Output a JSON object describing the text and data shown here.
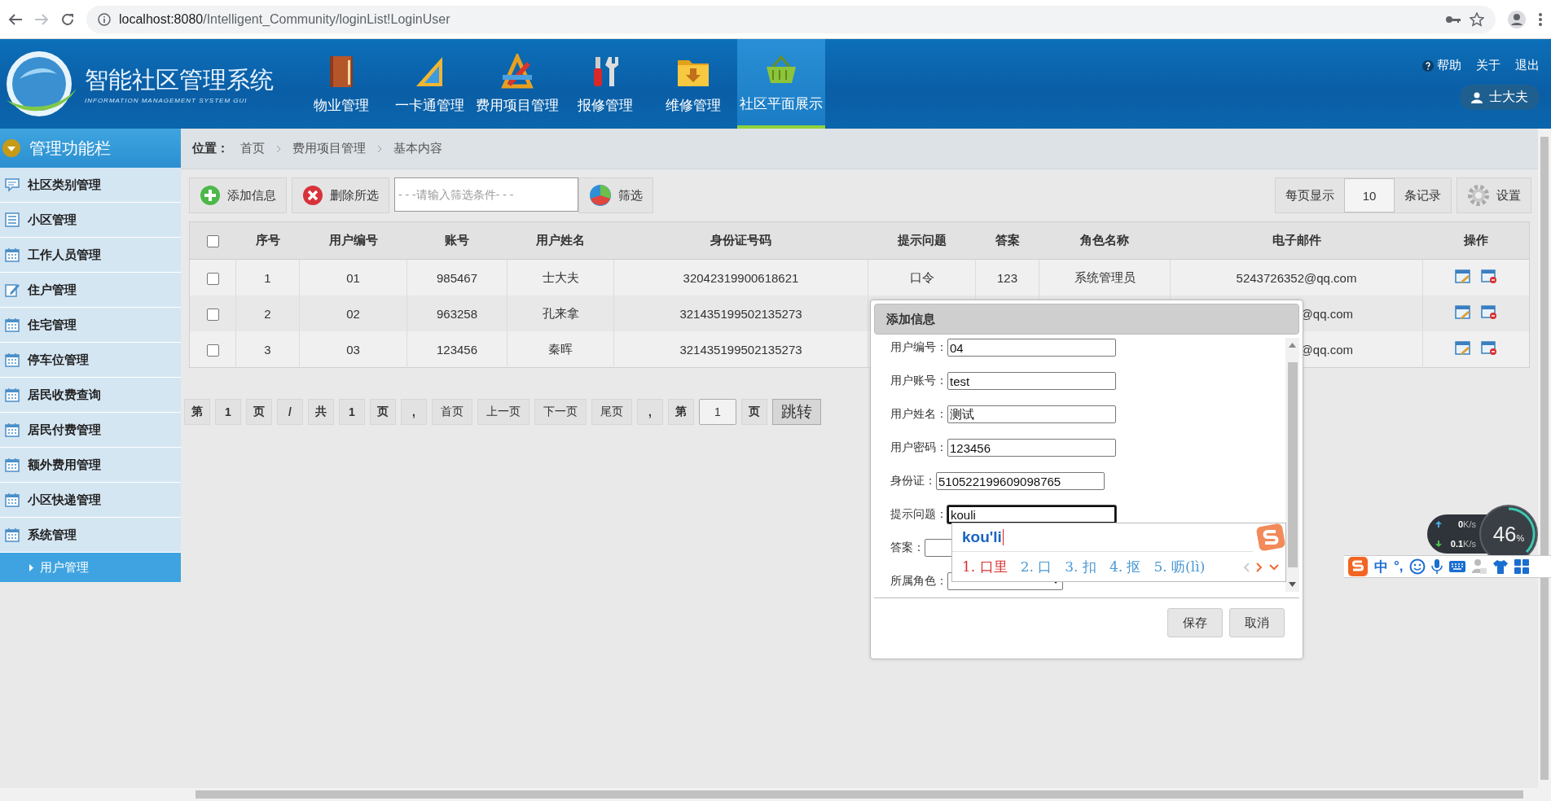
{
  "browser": {
    "url_host": "localhost:8080",
    "url_path": "/Intelligent_Community/loginList!LoginUser"
  },
  "header": {
    "title": "智能社区管理系统",
    "subtitle": "INFORMATION MANAGEMENT SYSTEM GUI",
    "nav": [
      {
        "label": "物业管理",
        "selected": false
      },
      {
        "label": "一卡通管理",
        "selected": false
      },
      {
        "label": "费用项目管理",
        "selected": false
      },
      {
        "label": "报修管理",
        "selected": false
      },
      {
        "label": "维修管理",
        "selected": false
      },
      {
        "label": "社区平面展示",
        "selected": true
      }
    ],
    "links": [
      "帮助",
      "关于",
      "退出"
    ],
    "user": "士大夫"
  },
  "sidebar": {
    "title": "管理功能栏",
    "items": [
      {
        "label": "社区类别管理",
        "selected": false
      },
      {
        "label": "小区管理",
        "selected": false
      },
      {
        "label": "工作人员管理",
        "selected": false
      },
      {
        "label": "住户管理",
        "selected": false
      },
      {
        "label": "住宅管理",
        "selected": false
      },
      {
        "label": "停车位管理",
        "selected": false
      },
      {
        "label": "居民收费查询",
        "selected": false
      },
      {
        "label": "居民付费管理",
        "selected": false
      },
      {
        "label": "额外费用管理",
        "selected": false
      },
      {
        "label": "小区快递管理",
        "selected": false
      },
      {
        "label": "系统管理",
        "selected": false,
        "children": [
          {
            "label": "用户管理",
            "selected": true
          }
        ]
      }
    ]
  },
  "breadcrumb": {
    "label": "位置：",
    "items": [
      "首页",
      "费用项目管理",
      "基本内容"
    ]
  },
  "toolbar": {
    "add": "添加信息",
    "delete": "删除所选",
    "filter_placeholder": "- - -请输入筛选条件- - -",
    "filter": "筛选",
    "page_size_label": "每页显示",
    "page_size": "10",
    "page_size_unit": "条记录",
    "settings": "设置"
  },
  "table": {
    "header_checked": false,
    "columns": [
      "序号",
      "用户编号",
      "账号",
      "用户姓名",
      "身份证号码",
      "提示问题",
      "答案",
      "角色名称",
      "电子邮件",
      "操作"
    ],
    "rows": [
      {
        "checked": false,
        "no": "1",
        "user_no": "01",
        "account": "985467",
        "name": "士大夫",
        "id_card": "32042319900618621",
        "hint": "口令",
        "answer": "123",
        "role": "系统管理员",
        "email": "5243726352@qq.com"
      },
      {
        "checked": false,
        "no": "2",
        "user_no": "02",
        "account": "963258",
        "name": "孔来拿",
        "id_card": "321435199502135273",
        "email": "@qq.com"
      },
      {
        "checked": false,
        "no": "3",
        "user_no": "03",
        "account": "123456",
        "name": "秦晖",
        "id_card": "321435199502135273",
        "email": "@qq.com"
      }
    ]
  },
  "pager": [
    {
      "text": "第",
      "kind": "label"
    },
    {
      "text": "1",
      "kind": "label"
    },
    {
      "text": "页",
      "kind": "label"
    },
    {
      "text": "/",
      "kind": "label"
    },
    {
      "text": "共",
      "kind": "label"
    },
    {
      "text": "1",
      "kind": "label"
    },
    {
      "text": "页",
      "kind": "label"
    },
    {
      "text": ",",
      "kind": "label"
    },
    {
      "text": "首页",
      "kind": "link"
    },
    {
      "text": "上一页",
      "kind": "link"
    },
    {
      "text": "下一页",
      "kind": "link"
    },
    {
      "text": "尾页",
      "kind": "link"
    },
    {
      "text": ",",
      "kind": "label"
    },
    {
      "text": "第",
      "kind": "label"
    },
    {
      "text": "1",
      "kind": "input"
    },
    {
      "text": "页",
      "kind": "label"
    },
    {
      "text": "跳转",
      "kind": "button"
    }
  ],
  "dialog": {
    "title": "添加信息",
    "fields": [
      {
        "label": "用户编号：",
        "kind": "text",
        "value": "04",
        "focused": false
      },
      {
        "label": "用户账号：",
        "kind": "text",
        "value": "test",
        "focused": false
      },
      {
        "label": "用户姓名：",
        "kind": "text",
        "value": "测试",
        "focused": false
      },
      {
        "label": "用户密码：",
        "kind": "text",
        "value": "123456",
        "focused": false
      },
      {
        "label": "身份证：",
        "kind": "text",
        "value": "510522199609098765",
        "focused": false
      },
      {
        "label": "提示问题：",
        "kind": "text",
        "value": "kouli",
        "focused": true
      },
      {
        "label": "答案：",
        "kind": "text",
        "focused": false
      },
      {
        "label": "所属角色：",
        "kind": "select",
        "focused": false
      }
    ],
    "buttons": [
      "保存",
      "取消"
    ]
  },
  "ime": {
    "composition": "kou'li",
    "candidates": [
      {
        "text": "1. 口里",
        "selected": true
      },
      {
        "text": "2. 口",
        "selected": false
      },
      {
        "text": "3. 扣",
        "selected": false
      },
      {
        "text": "4. 抠",
        "selected": false
      },
      {
        "text": "5. 呖(lì)",
        "selected": false
      }
    ]
  },
  "net_widget": {
    "up": "0",
    "up_unit": "K/s",
    "down": "0.1",
    "down_unit": "K/s",
    "percent": "46",
    "percent_unit": "%"
  },
  "ime_toolbar": {
    "mode": "中",
    "punct": "°,"
  }
}
